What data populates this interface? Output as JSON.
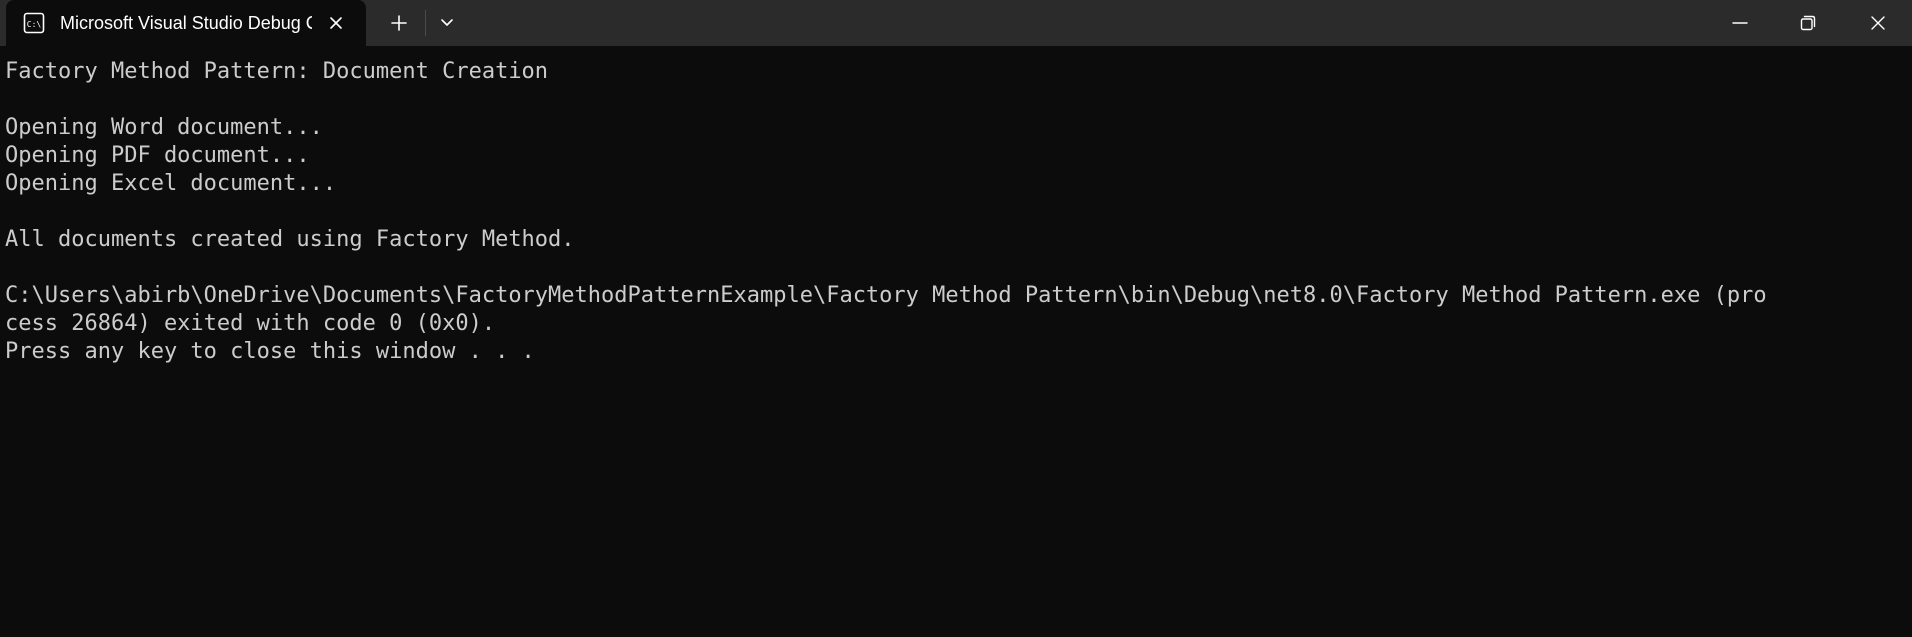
{
  "window": {
    "tab_title": "Microsoft Visual Studio Debug Console"
  },
  "icons": {
    "tab": "console-app-icon",
    "tab_close": "close-icon",
    "new_tab": "plus-icon",
    "dropdown": "chevron-down-icon",
    "minimize": "minimize-icon",
    "maximize": "restore-icon",
    "close": "close-icon"
  },
  "colors": {
    "background": "#0c0c0c",
    "titlebar": "#2b2b2b",
    "text": "#cccccc"
  },
  "console": {
    "lines": [
      "Factory Method Pattern: Document Creation",
      "",
      "Opening Word document...",
      "Opening PDF document...",
      "Opening Excel document...",
      "",
      "All documents created using Factory Method.",
      "",
      "C:\\Users\\abirb\\OneDrive\\Documents\\FactoryMethodPatternExample\\Factory Method Pattern\\bin\\Debug\\net8.0\\Factory Method Pattern.exe (pro",
      "cess 26864) exited with code 0 (0x0).",
      "Press any key to close this window . . ."
    ]
  }
}
